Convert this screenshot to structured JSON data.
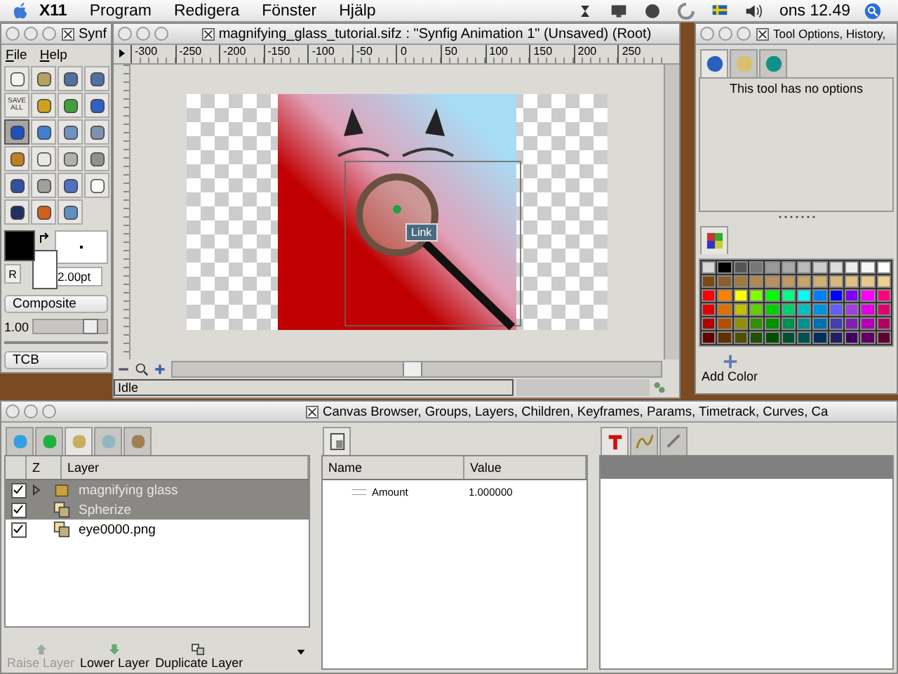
{
  "menubar": {
    "app": "X11",
    "menus": [
      "Program",
      "Redigera",
      "Fönster",
      "Hjälp"
    ],
    "clock": "ons 12.49"
  },
  "toolbox": {
    "title": "Synf",
    "menus": [
      "File",
      "Help"
    ],
    "tools": [
      {
        "selected": false
      },
      {
        "selected": false
      },
      {
        "selected": false
      },
      {
        "selected": false
      },
      {
        "label": "SAVE ALL",
        "selected": false
      },
      {
        "selected": false
      },
      {
        "selected": false
      },
      {
        "selected": false
      },
      {
        "selected": true
      },
      {
        "selected": false
      },
      {
        "selected": false
      },
      {
        "selected": false
      },
      {
        "selected": false
      },
      {
        "selected": false
      },
      {
        "selected": false
      },
      {
        "selected": false
      },
      {
        "selected": false
      },
      {
        "selected": false
      },
      {
        "selected": false
      },
      {
        "selected": false
      },
      {
        "selected": false
      },
      {
        "selected": false
      },
      {
        "selected": false
      }
    ],
    "outline": {
      "color": "#000000"
    },
    "fill": {
      "color": "#ffffff"
    },
    "reset": "R",
    "brush_size": "2.00pt",
    "blend": "Composite",
    "opacity": {
      "value": "1.00",
      "level": 0.85
    },
    "interpolation": "TCB"
  },
  "canvas_window": {
    "title": "magnifying_glass_tutorial.sifz : \"Synfig Animation 1\" (Unsaved) (Root)",
    "ruler": [
      "-300",
      "-250",
      "-200",
      "-150",
      "-100",
      "-50",
      "0",
      "50",
      "100",
      "150",
      "200",
      "250"
    ],
    "tooltip": "Link",
    "status": "Idle"
  },
  "tool_options": {
    "title": "Tool Options, History,",
    "tabs": [
      {
        "selected": true
      },
      {
        "selected": false
      },
      {
        "selected": false
      }
    ],
    "message": "This tool has no options",
    "palette": [
      {
        "swatches": [
          {
            "color": "#d8d8d8"
          },
          {
            "color": "#000000"
          },
          {
            "color": "#555555"
          },
          {
            "color": "#777777"
          },
          {
            "color": "#999999"
          },
          {
            "color": "#aaaaaa"
          },
          {
            "color": "#bbbbbb"
          },
          {
            "color": "#cccccc"
          },
          {
            "color": "#dddddd"
          },
          {
            "color": "#eeeeee"
          },
          {
            "color": "#f6f6f6"
          },
          {
            "color": "#ffffff"
          }
        ]
      },
      {
        "swatches": [
          {
            "color": "#7a4a10"
          },
          {
            "color": "#8a6030"
          },
          {
            "color": "#a07840"
          },
          {
            "color": "#b08850"
          },
          {
            "color": "#b89060"
          },
          {
            "color": "#c09a60"
          },
          {
            "color": "#c8a468"
          },
          {
            "color": "#d0b070"
          },
          {
            "color": "#d8b878"
          },
          {
            "color": "#e0c080"
          },
          {
            "color": "#e8c888"
          },
          {
            "color": "#f0d090"
          }
        ]
      },
      {
        "swatches": [
          {
            "color": "#ff0000"
          },
          {
            "color": "#ff8000"
          },
          {
            "color": "#ffff00"
          },
          {
            "color": "#80ff00"
          },
          {
            "color": "#00ff00"
          },
          {
            "color": "#00ff80"
          },
          {
            "color": "#00ffff"
          },
          {
            "color": "#0080ff"
          },
          {
            "color": "#0000ff"
          },
          {
            "color": "#8000ff"
          },
          {
            "color": "#ff00ff"
          },
          {
            "color": "#ff0080"
          }
        ]
      },
      {
        "swatches": [
          {
            "color": "#e00000"
          },
          {
            "color": "#e07000"
          },
          {
            "color": "#c0c000"
          },
          {
            "color": "#60d000"
          },
          {
            "color": "#00d000"
          },
          {
            "color": "#00d070"
          },
          {
            "color": "#00c0c0"
          },
          {
            "color": "#0090e0"
          },
          {
            "color": "#6060ff"
          },
          {
            "color": "#a040e0"
          },
          {
            "color": "#e000e0"
          },
          {
            "color": "#e00070"
          }
        ]
      },
      {
        "swatches": [
          {
            "color": "#b00000"
          },
          {
            "color": "#b05000"
          },
          {
            "color": "#909000"
          },
          {
            "color": "#309000"
          },
          {
            "color": "#009000"
          },
          {
            "color": "#009050"
          },
          {
            "color": "#009090"
          },
          {
            "color": "#0070b0"
          },
          {
            "color": "#4040b0"
          },
          {
            "color": "#8020b0"
          },
          {
            "color": "#b000b0"
          },
          {
            "color": "#b00060"
          }
        ]
      },
      {
        "swatches": [
          {
            "color": "#600000"
          },
          {
            "color": "#603000"
          },
          {
            "color": "#505000"
          },
          {
            "color": "#205000"
          },
          {
            "color": "#005000"
          },
          {
            "color": "#005030"
          },
          {
            "color": "#005050"
          },
          {
            "color": "#003060"
          },
          {
            "color": "#202060"
          },
          {
            "color": "#400060"
          },
          {
            "color": "#600060"
          },
          {
            "color": "#600030"
          }
        ]
      }
    ],
    "add_color": "Add Color"
  },
  "panels": {
    "title": "Canvas Browser, Groups, Layers, Children, Keyframes, Params, Timetrack, Curves, Ca",
    "layer_tabs": [
      {
        "selected": false
      },
      {
        "selected": false
      },
      {
        "selected": true
      },
      {
        "selected": false
      },
      {
        "selected": false
      }
    ],
    "layer_columns": [
      "Z",
      "Layer"
    ],
    "layers": [
      {
        "name": "magnifying glass",
        "kind": "group",
        "checked": true,
        "selected": true
      },
      {
        "name": "Spherize",
        "kind": "layer",
        "checked": true,
        "selected": true
      },
      {
        "name": "eye0000.png",
        "kind": "layer",
        "checked": true,
        "selected": false
      }
    ],
    "layer_buttons": [
      {
        "label": "Raise Layer",
        "disabled": true
      },
      {
        "label": "Lower Layer",
        "disabled": false
      },
      {
        "label": "Duplicate Layer",
        "disabled": false
      }
    ],
    "param_columns": [
      "Name",
      "Value"
    ],
    "params": [
      {
        "name": "Amount",
        "value": "1.000000"
      }
    ],
    "timetrack_tabs": [
      {
        "selected": true
      },
      {
        "selected": false
      },
      {
        "selected": false
      }
    ]
  }
}
